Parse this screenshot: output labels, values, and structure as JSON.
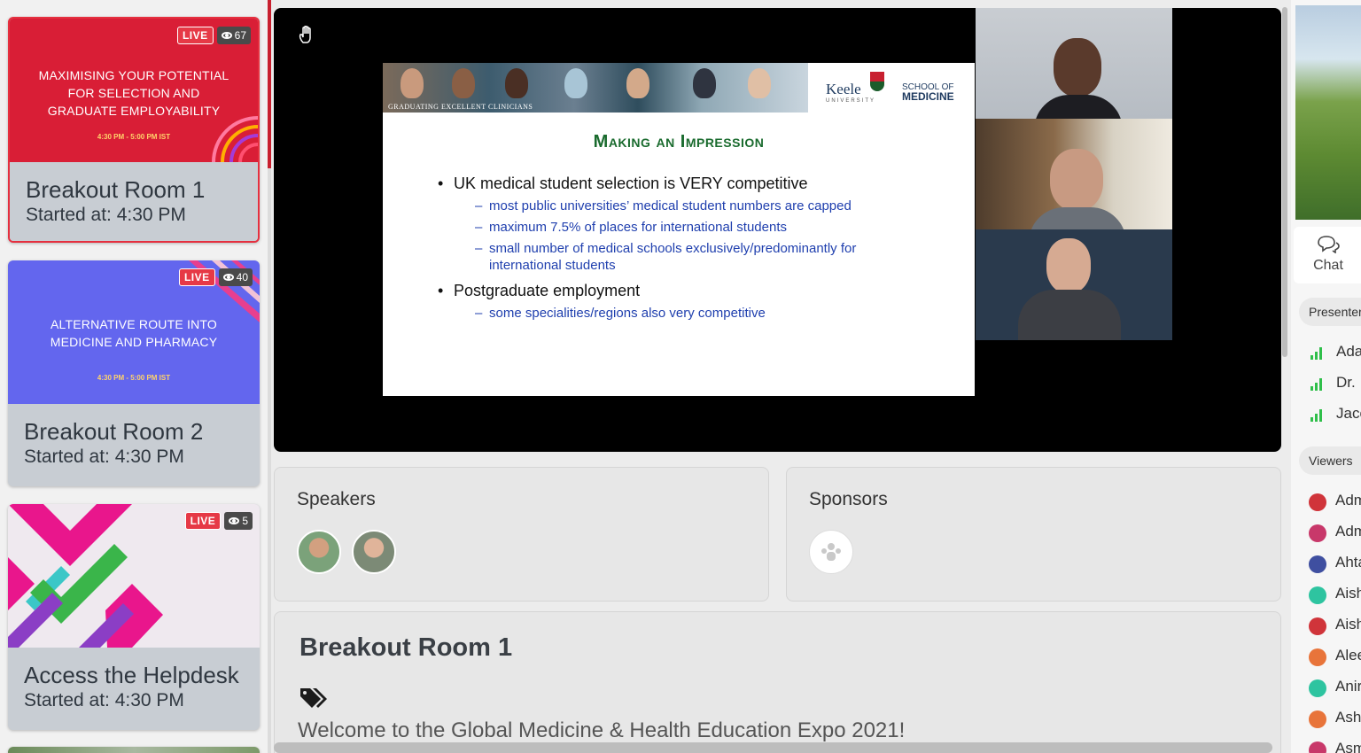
{
  "sidebar": {
    "cards": [
      {
        "title": "Breakout Room 1",
        "started": "Started at: 4:30 PM",
        "live": "LIVE",
        "views": "67",
        "thumb_lines": [
          "MAXIMISING YOUR POTENTIAL",
          "FOR SELECTION AND",
          "GRADUATE EMPLOYABILITY"
        ],
        "thumb_time": "4:30 PM - 5:00 PM IST",
        "color": "#d91e36"
      },
      {
        "title": "Breakout Room 2",
        "started": "Started at: 4:30 PM",
        "live": "LIVE",
        "views": "40",
        "thumb_lines": [
          "ALTERNATIVE ROUTE INTO",
          "MEDICINE AND PHARMACY"
        ],
        "thumb_time": "4:30 PM - 5:00 PM IST",
        "color": "#6366ee"
      },
      {
        "title": "Access the Helpdesk",
        "started": "Started at: 4:30 PM",
        "live": "LIVE",
        "views": "5"
      }
    ]
  },
  "slide": {
    "banner_caption": "GRADUATING EXCELLENT CLINICIANS",
    "logo_keele": "Keele",
    "logo_university": "UNIVERSITY",
    "school_of": "SCHOOL OF",
    "medicine": "MEDICINE",
    "title": "Making an Impression",
    "bullet1": "UK medical student selection is VERY competitive",
    "sub1": "most public universities’ medical student numbers are capped",
    "sub2": "maximum 7.5% of places for international students",
    "sub3": "small number of medical schools exclusively/predominantly for international students",
    "bullet2": "Postgraduate employment",
    "sub4": "some specialities/regions also very competitive"
  },
  "speakers": {
    "title": "Speakers"
  },
  "sponsors": {
    "title": "Sponsors"
  },
  "room": {
    "title": "Breakout Room 1",
    "description": "Welcome to the Global Medicine & Health Education Expo 2021!"
  },
  "right_panel": {
    "chat_label": "Chat",
    "presenters_label": "Presenters",
    "presenters": [
      "Ada",
      "Dr. ",
      "Jaco"
    ],
    "viewers_label": "Viewers",
    "viewers": [
      {
        "name": "Adm",
        "color": "#d0343a"
      },
      {
        "name": "Adm",
        "color": "#c8386a"
      },
      {
        "name": "Ahta",
        "color": "#3f4fa0"
      },
      {
        "name": "Aish",
        "color": "#2ec4a0"
      },
      {
        "name": "Aish",
        "color": "#d0343a"
      },
      {
        "name": "Alee",
        "color": "#e8743a"
      },
      {
        "name": "Anir",
        "color": "#2ec4a0"
      },
      {
        "name": "Ash",
        "color": "#e8743a"
      },
      {
        "name": "Asm",
        "color": "#c8386a"
      }
    ]
  },
  "icons": {
    "raise_hand": "raise-hand-icon",
    "tag": "tag-icon",
    "chat": "chat-icon",
    "eye": "eye-icon",
    "sponsor_placeholder": "people-icon",
    "signal": "signal-bars-icon"
  }
}
